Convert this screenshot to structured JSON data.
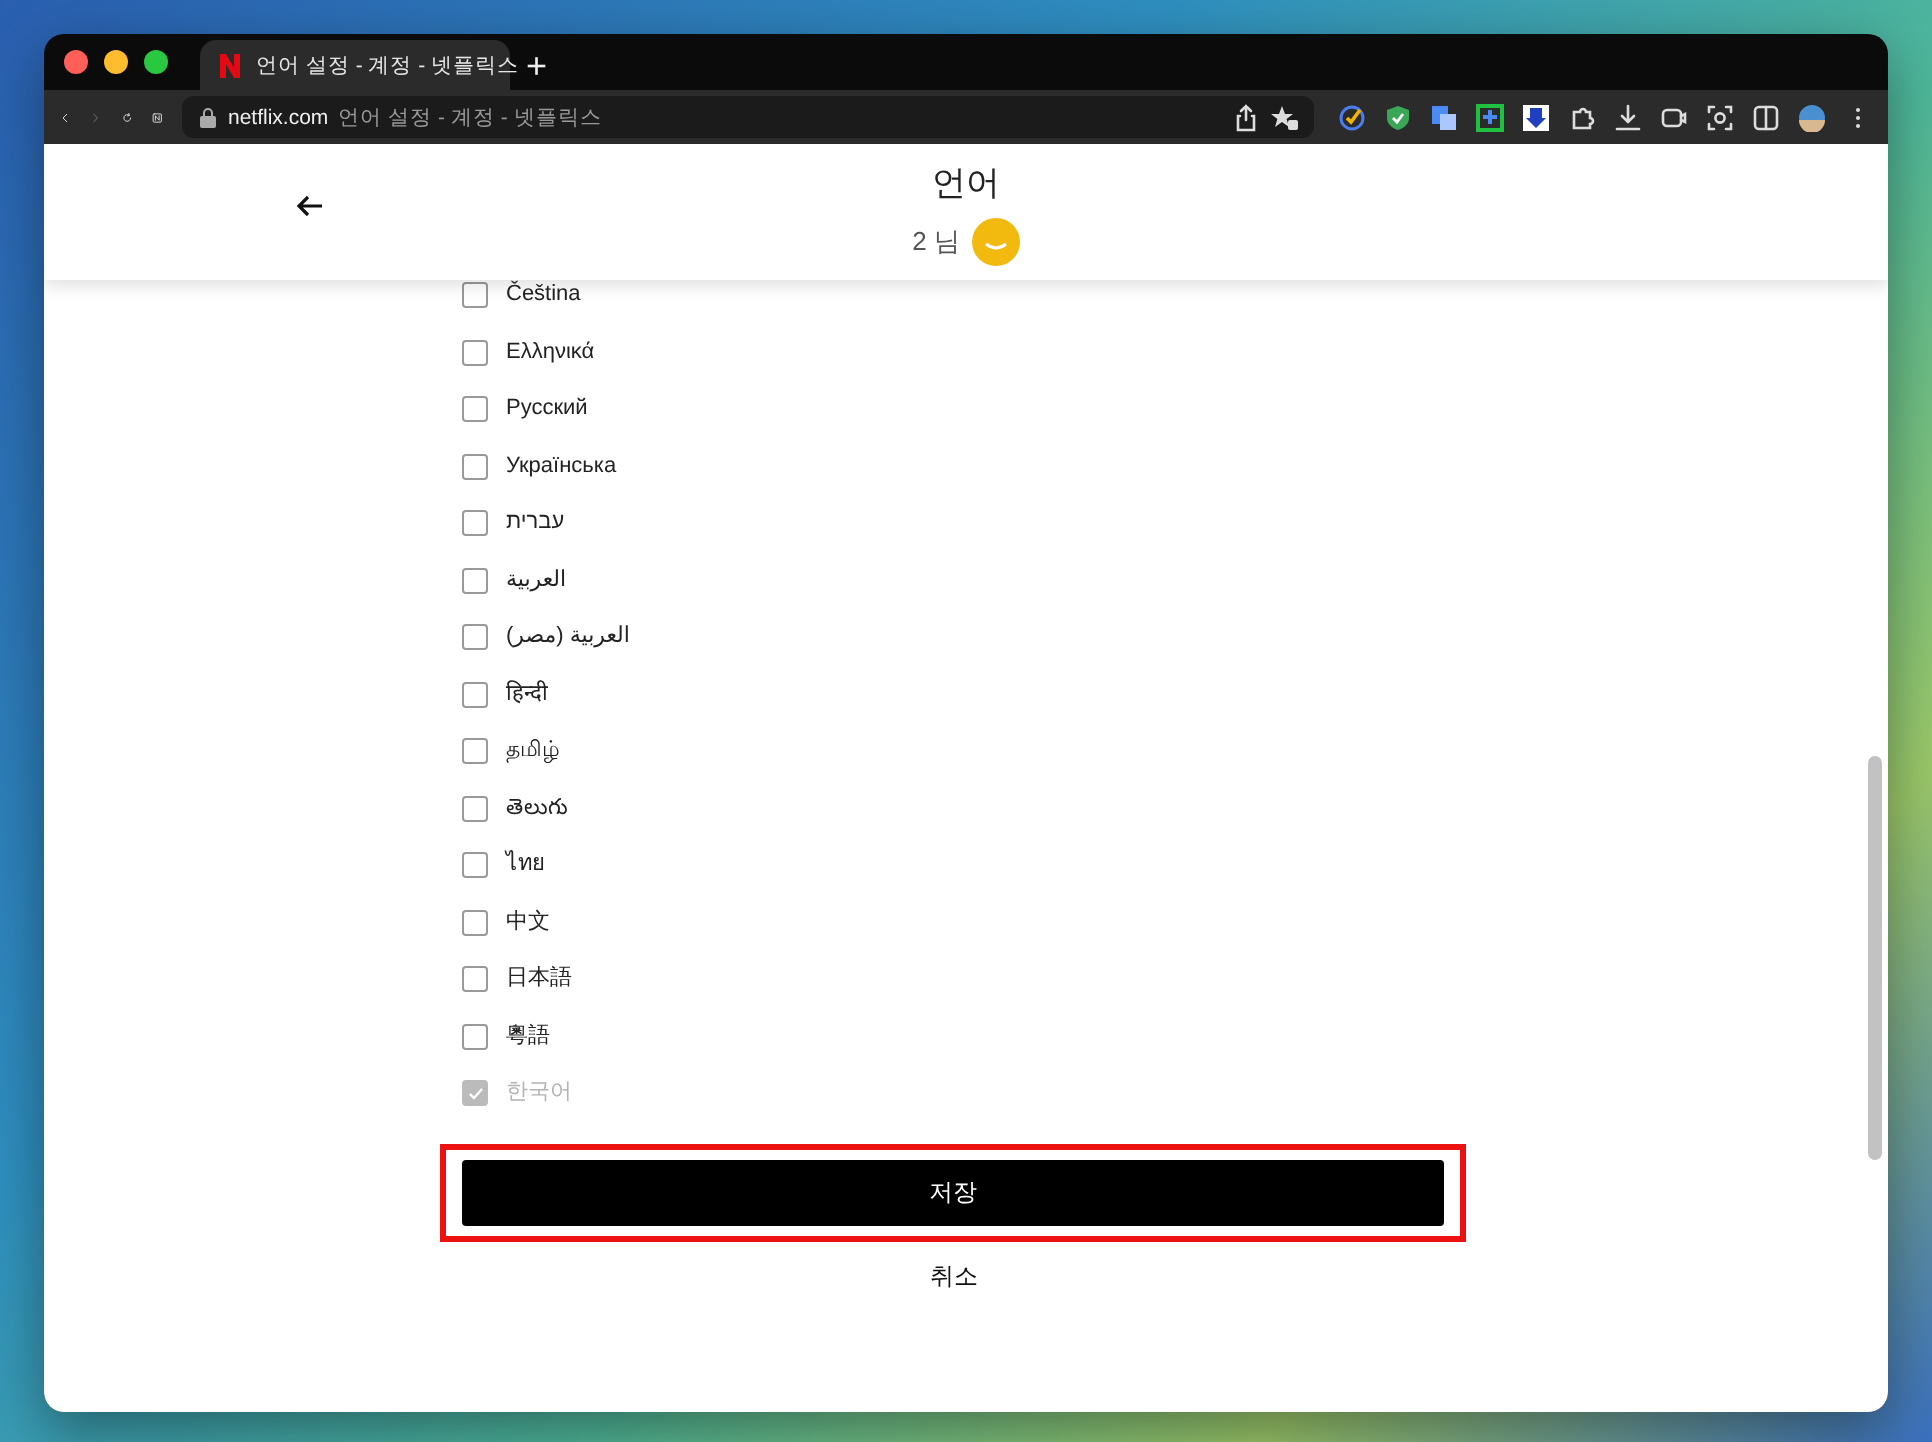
{
  "browser": {
    "tab": {
      "title": "언어 설정 - 계정 - 넷플릭스",
      "selected": true
    },
    "new_tab": "+",
    "address": {
      "domain": "netflix.com",
      "page_title": "언어 설정 - 계정 - 넷플릭스"
    }
  },
  "header": {
    "title": "언어",
    "profile": "2 님"
  },
  "languages": [
    {
      "label": "Čeština",
      "checked": false,
      "disabled": false
    },
    {
      "label": "Ελληνικά",
      "checked": false,
      "disabled": false
    },
    {
      "label": "Русский",
      "checked": false,
      "disabled": false
    },
    {
      "label": "Українська",
      "checked": false,
      "disabled": false
    },
    {
      "label": "עברית",
      "checked": false,
      "disabled": false
    },
    {
      "label": "العربية",
      "checked": false,
      "disabled": false
    },
    {
      "label": "العربية (مصر)",
      "checked": false,
      "disabled": false
    },
    {
      "label": "हिन्दी",
      "checked": false,
      "disabled": false
    },
    {
      "label": "தமிழ்",
      "checked": false,
      "disabled": false
    },
    {
      "label": "తెలుగు",
      "checked": false,
      "disabled": false
    },
    {
      "label": "ไทย",
      "checked": false,
      "disabled": false
    },
    {
      "label": "中文",
      "checked": false,
      "disabled": false
    },
    {
      "label": "日本語",
      "checked": false,
      "disabled": false
    },
    {
      "label": "粵語",
      "checked": false,
      "disabled": false
    },
    {
      "label": "한국어",
      "checked": true,
      "disabled": true
    }
  ],
  "save": {
    "label": "저장",
    "highlighted": true
  },
  "cancel": "취소"
}
